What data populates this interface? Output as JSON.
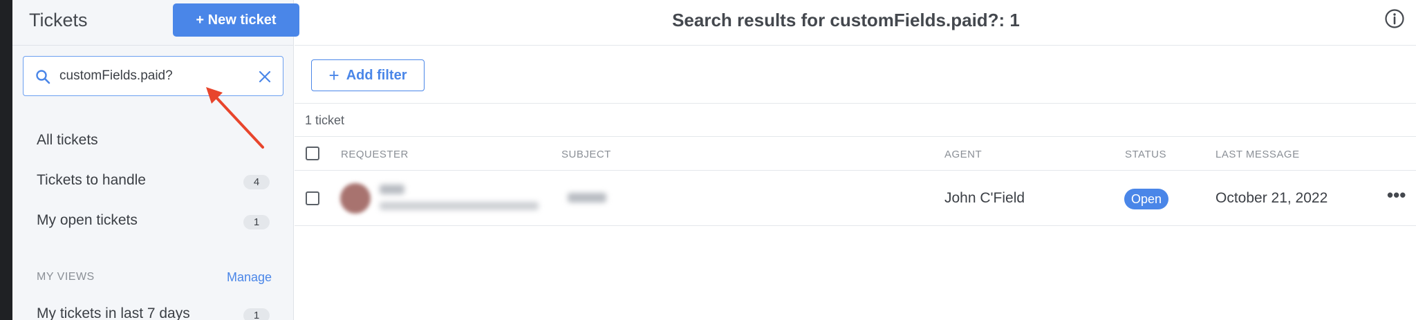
{
  "sidebar": {
    "title": "Tickets",
    "new_ticket_label": "+ New ticket",
    "search_value": "customFields.paid?",
    "nav": [
      {
        "label": "All tickets"
      },
      {
        "label": "Tickets to handle",
        "count": "4"
      },
      {
        "label": "My open tickets",
        "count": "1"
      }
    ],
    "views_label": "MY VIEWS",
    "manage_label": "Manage",
    "views": [
      {
        "label": "My tickets in last 7 days",
        "count": "1"
      }
    ]
  },
  "main": {
    "title": "Search results for customFields.paid?: 1",
    "add_filter_label": "Add filter",
    "ticket_count": "1 ticket",
    "columns": {
      "requester": "REQUESTER",
      "subject": "SUBJECT",
      "agent": "AGENT",
      "status": "STATUS",
      "last_message": "LAST MESSAGE"
    },
    "rows": [
      {
        "agent": "John C'Field",
        "status": "Open",
        "last_message": "October 21, 2022"
      }
    ]
  },
  "colors": {
    "accent": "#4a86e8",
    "annotation_arrow": "#e8452c",
    "sidebar_bg": "#f4f6f9"
  }
}
